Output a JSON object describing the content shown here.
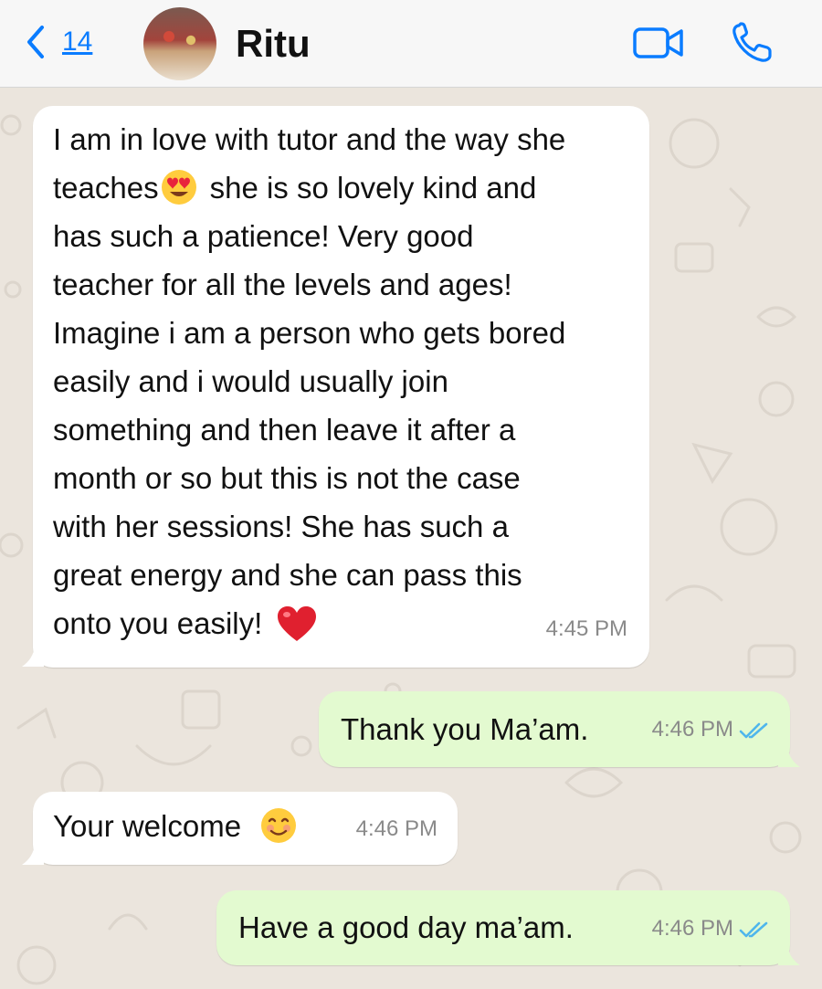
{
  "header": {
    "back_count": "14",
    "contact_name": "Ritu"
  },
  "messages": [
    {
      "direction": "incoming",
      "lines": [
        "I am in love with tutor and the way she",
        "teaches",
        "she is so lovely kind and",
        "has such a patience! Very good",
        "teacher for all the levels and ages!",
        "Imagine i am a person who gets bored",
        "easily and i would usually join",
        "something and then leave it after a",
        "month or so but this is not the case",
        "with her sessions! She has such a",
        "great energy and she can pass this",
        "onto you easily!"
      ],
      "time": "4:45 PM"
    },
    {
      "direction": "outgoing",
      "text": "Thank you Ma’am.",
      "time": "4:46 PM",
      "status": "read"
    },
    {
      "direction": "incoming",
      "text": "Your welcome",
      "time": "4:46 PM"
    },
    {
      "direction": "outgoing",
      "text": "Have a good day ma’am.",
      "time": "4:46 PM",
      "status": "read"
    }
  ],
  "colors": {
    "accent": "#0a7cff",
    "incoming_bubble": "#ffffff",
    "outgoing_bubble": "#e3fad0",
    "read_ticks": "#4fb6ec",
    "wallpaper": "#ebe5dd"
  },
  "icons": {
    "back": "chevron-left-icon",
    "video": "video-camera-icon",
    "call": "phone-icon",
    "emoji_1": "heart-eyes-emoji",
    "emoji_2": "red-heart-emoji",
    "emoji_3": "smiling-face-emoji"
  }
}
